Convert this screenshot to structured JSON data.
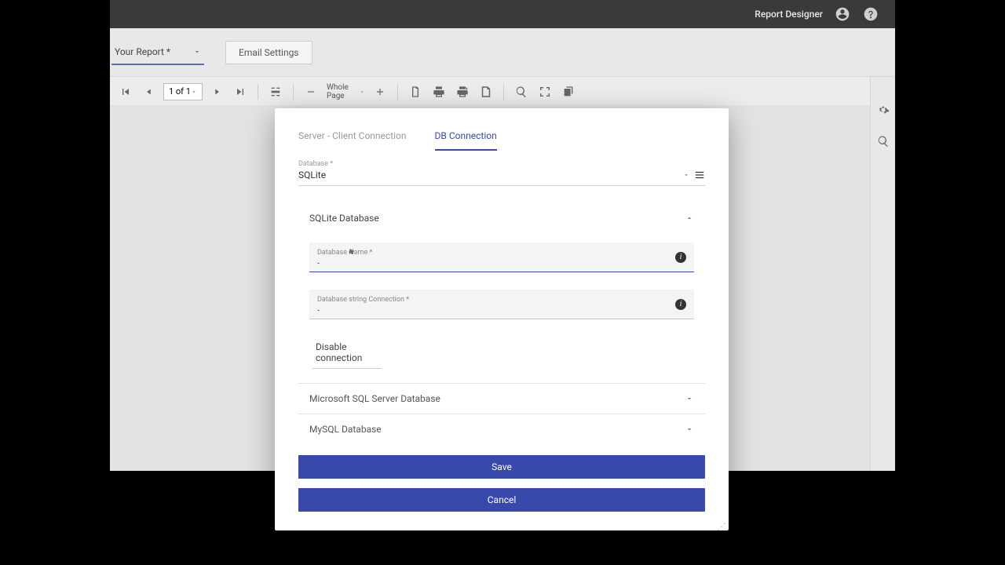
{
  "header": {
    "app_title": "Report Designer"
  },
  "secondary": {
    "report_dropdown_label": "Your Report *",
    "email_settings_label": "Email Settings"
  },
  "toolbar": {
    "page_indicator": "1 of 1",
    "zoom_label": "Whole Page"
  },
  "modal": {
    "tabs": {
      "server_client": "Server - Client Connection",
      "db_connection": "DB Connection"
    },
    "database_label": "Database *",
    "database_value": "SQLite",
    "sqlite": {
      "section_title": "SQLite Database",
      "db_name_label": "Database Name *",
      "db_name_value": "-",
      "conn_label": "Database string Connection *",
      "conn_value": "-",
      "disable_label": "Disable connection"
    },
    "mssql_title": "Microsoft SQL Server Database",
    "mysql_title": "MySQL Database",
    "save_label": "Save",
    "cancel_label": "Cancel"
  }
}
